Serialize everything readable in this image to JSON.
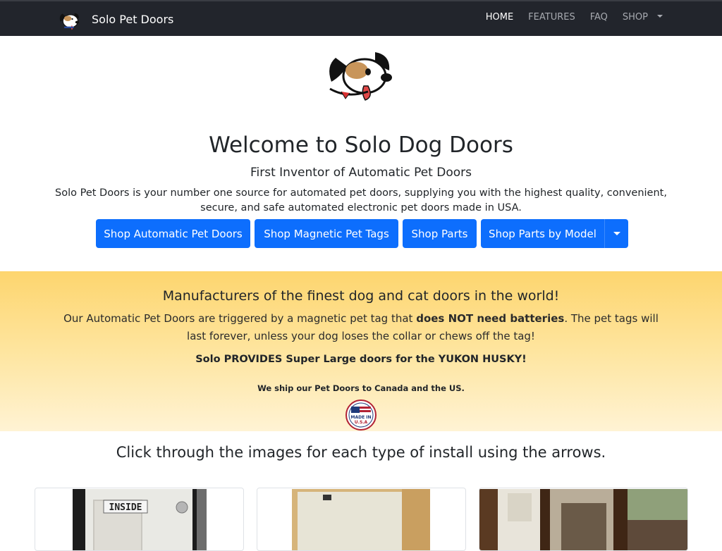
{
  "navbar": {
    "brand": "Solo Pet Doors",
    "links": [
      {
        "label": "HOME",
        "active": true
      },
      {
        "label": "FEATURES",
        "active": false
      },
      {
        "label": "FAQ",
        "active": false
      },
      {
        "label": "SHOP",
        "active": false,
        "dropdown": true
      }
    ]
  },
  "hero": {
    "title": "Welcome to Solo Dog Doors",
    "subtitle": "First Inventor of Automatic Pet Doors",
    "description": "Solo Pet Doors is your number one source for automated pet doors, supplying you with the highest quality, convenient, secure, and safe automated electronic pet doors made in USA.",
    "buttons": [
      "Shop Automatic Pet Doors",
      "Shop Magnetic Pet Tags",
      "Shop Parts",
      "Shop Parts by Model"
    ]
  },
  "banner": {
    "title": "Manufacturers of the finest dog and cat doors in the world!",
    "text_before": "Our Automatic Pet Doors are triggered by a magnetic pet tag that ",
    "text_bold": "does NOT need batteries",
    "text_after": ". The pet tags will last forever, unless your dog loses the collar or chews off the tag!",
    "highlight": "Solo PROVIDES Super Large doors for the YUKON HUSKY!",
    "shipping": "We ship our Pet Doors to Canada and the US.",
    "badge_text": "MADE IN U.S.A"
  },
  "install": {
    "title": "Click through the images for each type of install using the arrows.",
    "card1_sign": "INSIDE"
  },
  "colors": {
    "navbar_bg": "#22252c",
    "primary": "#0d6efd",
    "banner_top": "#fdd56e",
    "banner_bottom": "#fff3d4"
  }
}
